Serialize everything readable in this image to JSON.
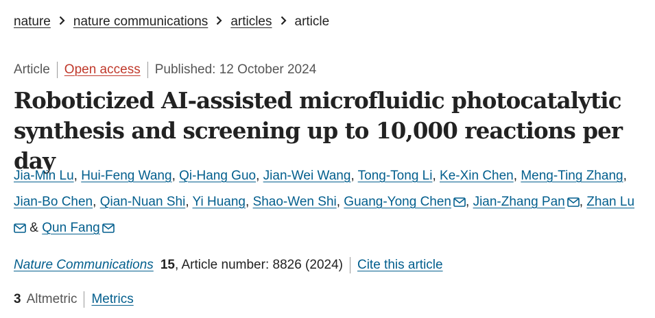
{
  "breadcrumb": {
    "items": [
      "nature",
      "nature communications",
      "articles"
    ],
    "current": "article"
  },
  "meta": {
    "type": "Article",
    "access": "Open access",
    "published": "Published: 12 October 2024"
  },
  "title": "Roboticized AI-assisted microfluidic photocatalytic synthesis and screening up to 10,000 reactions per day",
  "authors": [
    "Jia-Min Lu",
    "Hui-Feng Wang",
    "Qi-Hang Guo",
    "Jian-Wei Wang",
    "Tong-Tong Li",
    "Ke-Xin Chen",
    "Meng-Ting Zhang",
    "Jian-Bo Chen",
    "Qian-Nuan Shi",
    "Yi Huang",
    "Shao-Wen Shi",
    "Guang-Yong Chen",
    "Jian-Zhang Pan",
    "Zhan Lu",
    "Qun Fang"
  ],
  "authors_sep": ",",
  "authors_and": "&",
  "journal": {
    "name": "Nature Communications",
    "volume": "15",
    "article_info": ", Article number: 8826 (2024)",
    "cite": "Cite this article"
  },
  "metrics": {
    "altmetric_value": "3",
    "altmetric_label": "Altmetric",
    "metrics_link": "Metrics"
  },
  "colors": {
    "link": "#025e8d",
    "open_access": "#c0392b",
    "text": "#222222",
    "muted": "#555555"
  },
  "icons": {
    "chevron": "chevron-right-icon",
    "mail": "mail-icon"
  }
}
